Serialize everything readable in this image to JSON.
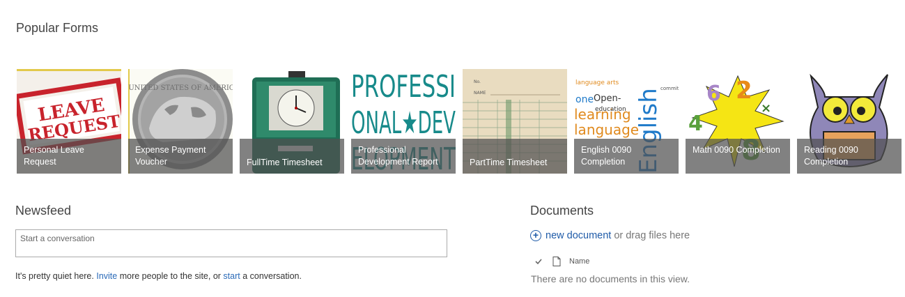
{
  "popular_forms": {
    "title": "Popular Forms",
    "tiles": [
      {
        "label": "Personal Leave Request",
        "image_text": "LEAVE REQUEST"
      },
      {
        "label": "Expense Payment Voucher",
        "image_text": ""
      },
      {
        "label": "FullTime Timesheet",
        "image_text": ""
      },
      {
        "label": "Professional Development Report",
        "image_text": "PROFESSI ONAL★DEV ELOPMENT"
      },
      {
        "label": "PartTime Timesheet",
        "image_text": "NAME"
      },
      {
        "label": "English 0090 Completion",
        "image_text": "English"
      },
      {
        "label": "Math 0090 Completion",
        "image_text": ""
      },
      {
        "label": "Reading 0090 Completion",
        "image_text": ""
      }
    ]
  },
  "newsfeed": {
    "title": "Newsfeed",
    "placeholder": "Start a conversation",
    "quiet_before": "It's pretty quiet here. ",
    "invite_link": "Invite",
    "quiet_middle": " more people to the site, or ",
    "start_link": "start",
    "quiet_after": " a conversation."
  },
  "documents": {
    "title": "Documents",
    "new_document_link": "new document",
    "drag_text": "or drag files here",
    "column_name": "Name",
    "empty_text": "There are no documents in this view."
  },
  "colors": {
    "link": "#1f5ba8",
    "caption_overlay": "#505050",
    "teal": "#178a8a"
  }
}
